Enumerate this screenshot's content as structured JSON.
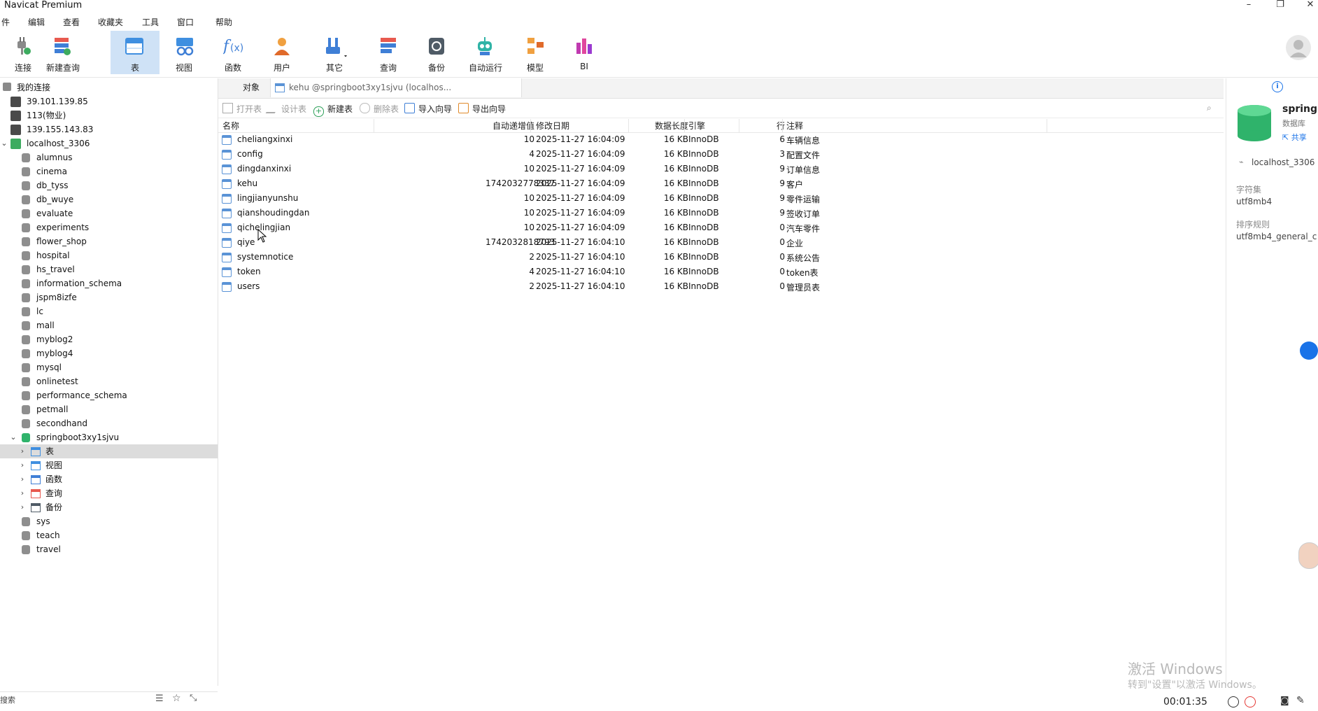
{
  "window": {
    "title": "Navicat Premium"
  },
  "menu": [
    "件",
    "编辑",
    "查看",
    "收藏夹",
    "工具",
    "窗口",
    "帮助"
  ],
  "toolbar": [
    {
      "label": "连接",
      "icon": "plug-icon"
    },
    {
      "label": "新建查询",
      "icon": "new-query-icon"
    },
    {
      "label": "表",
      "icon": "table-icon"
    },
    {
      "label": "视图",
      "icon": "view-icon"
    },
    {
      "label": "函数",
      "icon": "function-icon"
    },
    {
      "label": "用户",
      "icon": "user-icon"
    },
    {
      "label": "其它",
      "icon": "tools-icon"
    },
    {
      "label": "查询",
      "icon": "query-icon"
    },
    {
      "label": "备份",
      "icon": "backup-icon"
    },
    {
      "label": "自动运行",
      "icon": "robot-icon"
    },
    {
      "label": "模型",
      "icon": "model-icon"
    },
    {
      "label": "BI",
      "icon": "bi-chart-icon"
    }
  ],
  "tree": {
    "header": "我的连接",
    "connections": [
      "39.101.139.85",
      "113(物业)",
      "139.155.143.83",
      "localhost_3306"
    ],
    "databases": [
      "alumnus",
      "cinema",
      "db_tyss",
      "db_wuye",
      "evaluate",
      "experiments",
      "flower_shop",
      "hospital",
      "hs_travel",
      "information_schema",
      "jspm8izfe",
      "lc",
      "mall",
      "myblog2",
      "myblog4",
      "mysql",
      "onlinetest",
      "performance_schema",
      "petmall",
      "secondhand",
      "springboot3xy1sjvu"
    ],
    "sub_items": [
      "表",
      "视图",
      "函数",
      "查询",
      "备份"
    ],
    "databases_after": [
      "sys",
      "teach",
      "travel"
    ],
    "search_label": "搜索"
  },
  "tabs": {
    "objects": "对象",
    "document": "kehu @springboot3xy1sjvu (localhos..."
  },
  "obj_toolbar": {
    "open": "打开表",
    "design": "设计表",
    "new": "新建表",
    "delete": "删除表",
    "import": "导入向导",
    "export": "导出向导"
  },
  "table": {
    "headers": {
      "name": "名称",
      "auto_inc": "自动递增值",
      "modified": "修改日期",
      "data_len": "数据长度",
      "engine": "引擎",
      "rows": "行",
      "comment": "注释"
    },
    "rows": [
      {
        "name": "cheliangxinxi",
        "auto_inc": "10",
        "modified": "2025-11-27 16:04:09",
        "data_len": "16 KB",
        "engine": "InnoDB",
        "rows": "6",
        "comment": "车辆信息"
      },
      {
        "name": "config",
        "auto_inc": "4",
        "modified": "2025-11-27 16:04:09",
        "data_len": "16 KB",
        "engine": "InnoDB",
        "rows": "3",
        "comment": "配置文件"
      },
      {
        "name": "dingdanxinxi",
        "auto_inc": "10",
        "modified": "2025-11-27 16:04:09",
        "data_len": "16 KB",
        "engine": "InnoDB",
        "rows": "9",
        "comment": "订单信息"
      },
      {
        "name": "kehu",
        "auto_inc": "1742032778337",
        "modified": "2025-11-27 16:04:09",
        "data_len": "16 KB",
        "engine": "InnoDB",
        "rows": "9",
        "comment": "客户"
      },
      {
        "name": "lingjianyunshu",
        "auto_inc": "10",
        "modified": "2025-11-27 16:04:09",
        "data_len": "16 KB",
        "engine": "InnoDB",
        "rows": "9",
        "comment": "零件运输"
      },
      {
        "name": "qianshoudingdan",
        "auto_inc": "10",
        "modified": "2025-11-27 16:04:09",
        "data_len": "16 KB",
        "engine": "InnoDB",
        "rows": "9",
        "comment": "签收订单"
      },
      {
        "name": "qichelingjian",
        "auto_inc": "10",
        "modified": "2025-11-27 16:04:09",
        "data_len": "16 KB",
        "engine": "InnoDB",
        "rows": "0",
        "comment": "汽车零件"
      },
      {
        "name": "qiye",
        "auto_inc": "1742032818793",
        "modified": "2025-11-27 16:04:10",
        "data_len": "16 KB",
        "engine": "InnoDB",
        "rows": "0",
        "comment": "企业"
      },
      {
        "name": "systemnotice",
        "auto_inc": "2",
        "modified": "2025-11-27 16:04:10",
        "data_len": "16 KB",
        "engine": "InnoDB",
        "rows": "0",
        "comment": "系统公告"
      },
      {
        "name": "token",
        "auto_inc": "4",
        "modified": "2025-11-27 16:04:10",
        "data_len": "16 KB",
        "engine": "InnoDB",
        "rows": "0",
        "comment": "token表"
      },
      {
        "name": "users",
        "auto_inc": "2",
        "modified": "2025-11-27 16:04:10",
        "data_len": "16 KB",
        "engine": "InnoDB",
        "rows": "0",
        "comment": "管理员表"
      }
    ]
  },
  "info": {
    "db_name": "springb",
    "db_type": "数据库",
    "share": "共享",
    "connection": "localhost_3306",
    "charset_label": "字符集",
    "charset": "utf8mb4",
    "collation_label": "排序规则",
    "collation": "utf8mb4_general_c"
  },
  "watermark": {
    "line1": "激活 Windows",
    "line2": "转到\"设置\"以激活 Windows。"
  },
  "recorder": {
    "time": "00:01:35"
  },
  "colors": {
    "accent": "#1a73e8",
    "selected_tool": "#cfe2f6",
    "db_green": "#2fb36b",
    "record_red": "#e53935"
  }
}
